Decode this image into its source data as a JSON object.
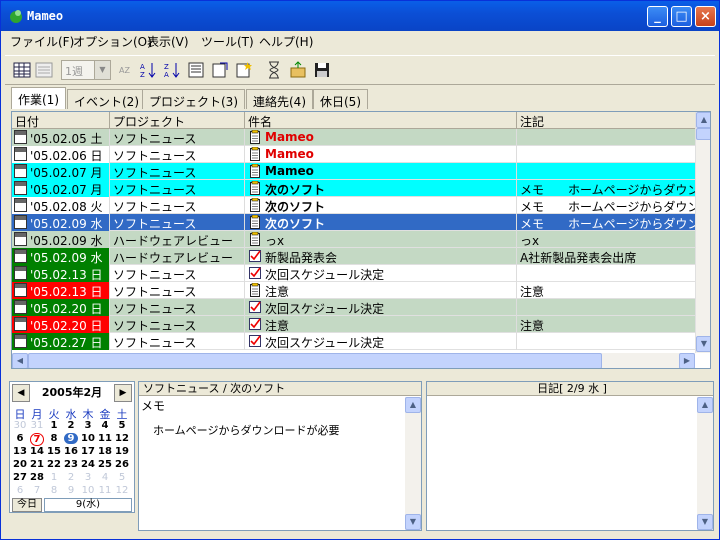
{
  "window": {
    "title": "Mameo"
  },
  "menu": [
    "ファイル(F)",
    "オプション(O)",
    "表示(V)",
    "ツール(T)",
    "ヘルプ(H)"
  ],
  "toolbar": {
    "period_select": "1週"
  },
  "tabs": [
    "作業(1)",
    "イベント(2)",
    "プロジェクト(3)",
    "連絡先(4)",
    "休日(5)"
  ],
  "grid": {
    "headers": [
      "日付",
      "プロジェクト",
      "件名",
      "注記"
    ],
    "rows": [
      {
        "date": "'05.02.05 土",
        "project": "ソフトニュース",
        "item": "Mameo",
        "note": "",
        "bg": "#c4d9c4",
        "date_bg": "#c4d9c4",
        "item_color": "#e00000",
        "bold": true,
        "icon": "memo"
      },
      {
        "date": "'05.02.06 日",
        "project": "ソフトニュース",
        "item": "Mameo",
        "note": "",
        "bg": "#ffffff",
        "date_bg": "#ffffff",
        "item_color": "#e00000",
        "bold": true,
        "icon": "memo"
      },
      {
        "date": "'05.02.07 月",
        "project": "ソフトニュース",
        "item": "Mameo",
        "note": "",
        "bg": "#00ffff",
        "date_bg": "#00ffff",
        "item_color": "#000000",
        "bold": true,
        "icon": "memo"
      },
      {
        "date": "'05.02.07 月",
        "project": "ソフトニュース",
        "item": "次のソフト",
        "note": "メモ　　ホームページからダウン",
        "bg": "#00ffff",
        "date_bg": "#00ffff",
        "item_color": "#000000",
        "bold": true,
        "icon": "memo"
      },
      {
        "date": "'05.02.08 火",
        "project": "ソフトニュース",
        "item": "次のソフト",
        "note": "メモ　　ホームページからダウン",
        "bg": "#ffffff",
        "date_bg": "#ffffff",
        "item_color": "#000000",
        "bold": true,
        "icon": "memo"
      },
      {
        "date": "'05.02.09 水",
        "project": "ソフトニュース",
        "item": "次のソフト",
        "note": "メモ　　ホームページからダウン",
        "bg": "#316ac5",
        "date_bg": "#316ac5",
        "item_color": "#ffffff",
        "bold": true,
        "icon": "memo",
        "selected": true
      },
      {
        "date": "'05.02.09 水",
        "project": "ハードウェアレビュー",
        "item": "っx",
        "note": "っx",
        "bg": "#c4d9c4",
        "date_bg": "#c4d9c4",
        "item_color": "#000000",
        "bold": false,
        "icon": "memo"
      },
      {
        "date": "'05.02.09 水",
        "project": "ハードウェアレビュー",
        "item": "新製品発表会",
        "note": "A社新製品発表会出席",
        "bg": "#c4d9c4",
        "date_bg": "#008000",
        "item_color": "#000000",
        "bold": false,
        "icon": "check"
      },
      {
        "date": "'05.02.13 日",
        "project": "ソフトニュース",
        "item": "次回スケジュール決定",
        "note": "",
        "bg": "#ffffff",
        "date_bg": "#008000",
        "item_color": "#000000",
        "bold": false,
        "icon": "check"
      },
      {
        "date": "'05.02.13 日",
        "project": "ソフトニュース",
        "item": "注意",
        "note": "注意",
        "bg": "#ffffff",
        "date_bg": "#ff0000",
        "item_color": "#000000",
        "bold": false,
        "icon": "memo"
      },
      {
        "date": "'05.02.20 日",
        "project": "ソフトニュース",
        "item": "次回スケジュール決定",
        "note": "",
        "bg": "#c4d9c4",
        "date_bg": "#008000",
        "item_color": "#000000",
        "bold": false,
        "icon": "check"
      },
      {
        "date": "'05.02.20 日",
        "project": "ソフトニュース",
        "item": "注意",
        "note": "注意",
        "bg": "#c4d9c4",
        "date_bg": "#ff0000",
        "item_color": "#000000",
        "bold": false,
        "icon": "check"
      },
      {
        "date": "'05.02.27 日",
        "project": "ソフトニュース",
        "item": "次回スケジュール決定",
        "note": "",
        "bg": "#ffffff",
        "date_bg": "#008000",
        "item_color": "#000000",
        "bold": false,
        "icon": "check"
      }
    ]
  },
  "calendar": {
    "month_label": "2005年2月",
    "weekdays": [
      "日",
      "月",
      "火",
      "水",
      "木",
      "金",
      "土"
    ],
    "weeks": [
      [
        "30",
        "31",
        "1",
        "2",
        "3",
        "4",
        "5"
      ],
      [
        "6",
        "7",
        "8",
        "9",
        "10",
        "11",
        "12"
      ],
      [
        "13",
        "14",
        "15",
        "16",
        "17",
        "18",
        "19"
      ],
      [
        "20",
        "21",
        "22",
        "23",
        "24",
        "25",
        "26"
      ],
      [
        "27",
        "28",
        "1",
        "2",
        "3",
        "4",
        "5"
      ],
      [
        "6",
        "7",
        "8",
        "9",
        "10",
        "11",
        "12"
      ]
    ],
    "today_button": "今日",
    "today_value": "9(水)"
  },
  "memo_panel": {
    "header": "ソフトニュース / 次のソフト",
    "label": "メモ",
    "body": "ホームページからダウンロードが必要"
  },
  "diary_panel": {
    "header": "日記[ 2/9 水 ]"
  }
}
